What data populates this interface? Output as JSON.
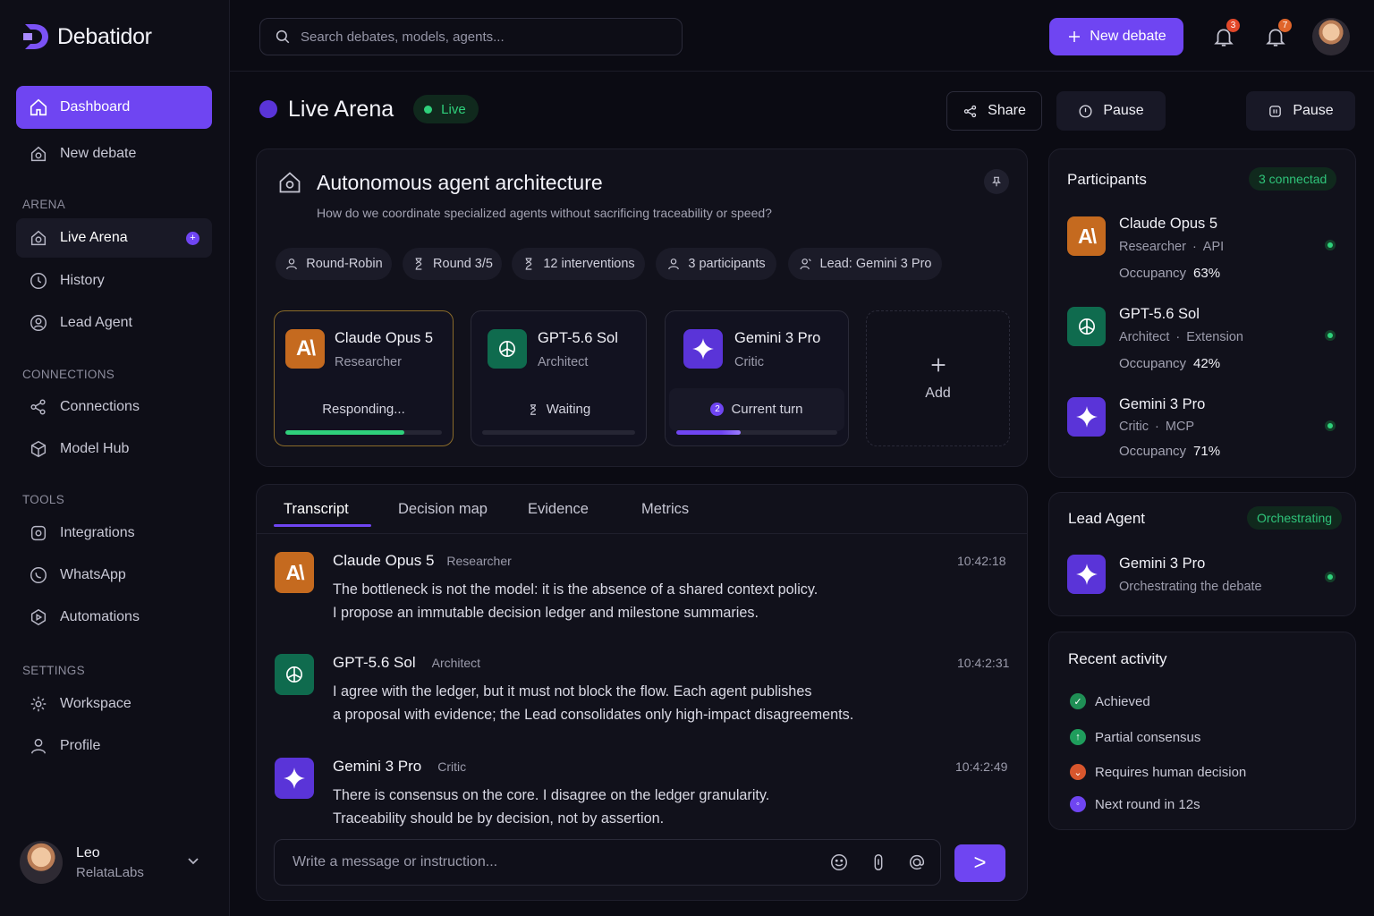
{
  "app": {
    "name": "Debatidor"
  },
  "sidebar": {
    "items": [
      {
        "label": "Dashboard"
      },
      {
        "label": "New debate"
      }
    ],
    "sections": {
      "arena": {
        "title": "ARENA",
        "items": [
          {
            "label": "Live Arena",
            "badge": "+"
          },
          {
            "label": "History"
          },
          {
            "label": "Lead Agent"
          }
        ]
      },
      "connections": {
        "title": "CONNECTIONS",
        "items": [
          {
            "label": "Connections"
          },
          {
            "label": "Model Hub"
          }
        ]
      },
      "tools": {
        "title": "TOOLS",
        "items": [
          {
            "label": "Integrations"
          },
          {
            "label": "WhatsApp"
          },
          {
            "label": "Automations"
          }
        ]
      },
      "settings": {
        "title": "SETTINGS",
        "items": [
          {
            "label": "Workspace"
          },
          {
            "label": "Profile"
          }
        ]
      }
    },
    "user": {
      "name": "Leo",
      "org": "RelataLabs"
    }
  },
  "topbar": {
    "search_placeholder": "Search debates, models, agents...",
    "new_debate_label": "New debate",
    "notifications_count": "3",
    "alerts_count": "7"
  },
  "header": {
    "title": "Live Arena",
    "status": "Live",
    "share_label": "Share",
    "pause_label": "Pause",
    "pause2_label": "Pause"
  },
  "topic": {
    "title": "Autonomous agent architecture",
    "subtitle": "How do we coordinate specialized agents without sacrificing traceability or speed?",
    "chips": [
      "Round-Robin",
      "Round 3/5",
      "12 interventions",
      "3 participants",
      "Lead: Gemini 3 Pro"
    ]
  },
  "agents": [
    {
      "name": "Claude Opus 5",
      "role": "Researcher",
      "status": "Responding...",
      "progress": 0.76,
      "color": "#c56a1f"
    },
    {
      "name": "GPT-5.6 Sol",
      "role": "Architect",
      "status": "Waiting",
      "progress": 0,
      "color": "#0f6b4e"
    },
    {
      "name": "Gemini 3 Pro",
      "role": "Critic",
      "status": "Current turn",
      "turn_number": "2",
      "progress": 0.4,
      "color": "#5a34d8"
    }
  ],
  "add_label": "Add",
  "tabs": [
    "Transcript",
    "Decision map",
    "Evidence",
    "Metrics"
  ],
  "messages": [
    {
      "name": "Claude Opus 5",
      "role": "Researcher",
      "time": "10:42:18",
      "lines": [
        "The bottleneck is not the model: it is the absence of a shared context policy.",
        "I propose an immutable decision ledger and milestone summaries."
      ]
    },
    {
      "name": "GPT-5.6 Sol",
      "role": "Architect",
      "time": "10:4:2:31",
      "lines": [
        "I agree with the ledger, but it must not block the flow. Each agent publishes",
        "a proposal with evidence; the Lead consolidates only high-impact disagreements."
      ]
    },
    {
      "name": "Gemini 3 Pro",
      "role": "Critic",
      "time": "10:4:2:49",
      "lines": [
        "There is consensus on the core. I disagree on the ledger granularity.",
        "Traceability should be by decision, not by assertion."
      ]
    }
  ],
  "composer": {
    "placeholder": "Write a message or instruction...",
    "send_label": ">"
  },
  "participants": {
    "title": "Participants",
    "connected": "3 connectad",
    "occupancy_label": "Occupancy",
    "items": [
      {
        "name": "Claude Opus 5",
        "role": "Researcher",
        "conn": "API",
        "occupancy": "63%"
      },
      {
        "name": "GPT-5.6 Sol",
        "role": "Architect",
        "conn": "Extension",
        "occupancy": "42%"
      },
      {
        "name": "Gemini 3 Pro",
        "role": "Critic",
        "conn": "MCP",
        "occupancy": "71%"
      }
    ]
  },
  "lead": {
    "title": "Lead Agent",
    "status": "Orchestrating",
    "name": "Gemini 3 Pro",
    "desc": "Orchestrating the debate"
  },
  "activity": {
    "title": "Recent activity",
    "items": [
      {
        "label": "Achieved",
        "color": "#1f8f55"
      },
      {
        "label": "Partial consensus",
        "color": "#1f9d5c"
      },
      {
        "label": "Requires human decision",
        "color": "#d8562d"
      },
      {
        "label": "Next round in 12s",
        "color": "#6f45f2"
      }
    ]
  },
  "colors": {
    "accent": "#6f45f2",
    "live": "#2fd07b",
    "background": "#0b0b13"
  }
}
